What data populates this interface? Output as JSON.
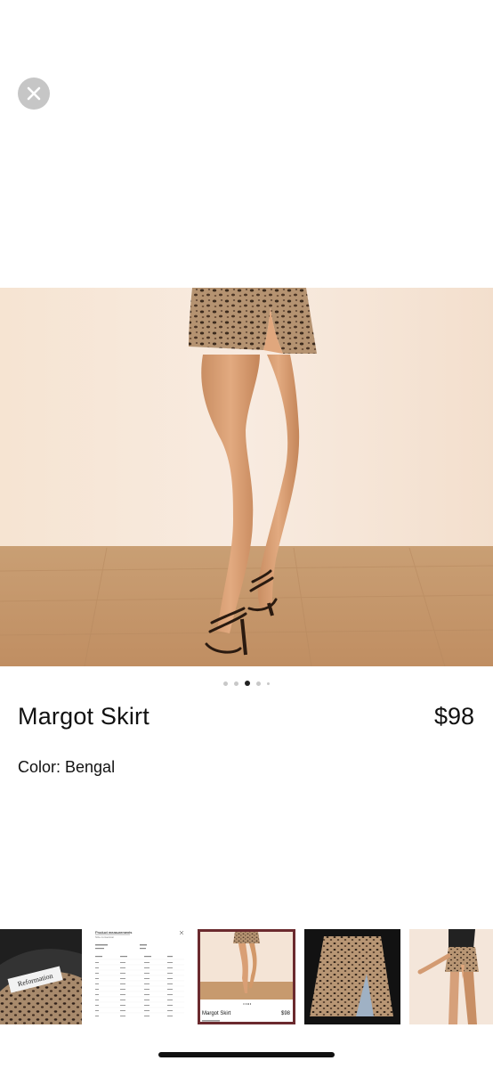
{
  "product": {
    "title": "Margot Skirt",
    "price": "$98",
    "color_label": "Color: Bengal"
  },
  "carousel": {
    "dot_count": 5,
    "active_index": 2
  },
  "thumbnails": {
    "items": [
      {
        "kind": "label-closeup",
        "label_text": "Reformation"
      },
      {
        "kind": "size-chart",
        "title": "Product measurements",
        "subtitle": "Size conversion"
      },
      {
        "kind": "product-screenshot",
        "title": "Margot Skirt",
        "price": "$98"
      },
      {
        "kind": "flat-lay"
      },
      {
        "kind": "side-view"
      }
    ],
    "selected_index": 2
  },
  "colors": {
    "close_bg": "#c6c6c6",
    "selected_outline": "#6b2a2e",
    "wall": "#f4e4d6",
    "floor": "#c79a6e"
  }
}
